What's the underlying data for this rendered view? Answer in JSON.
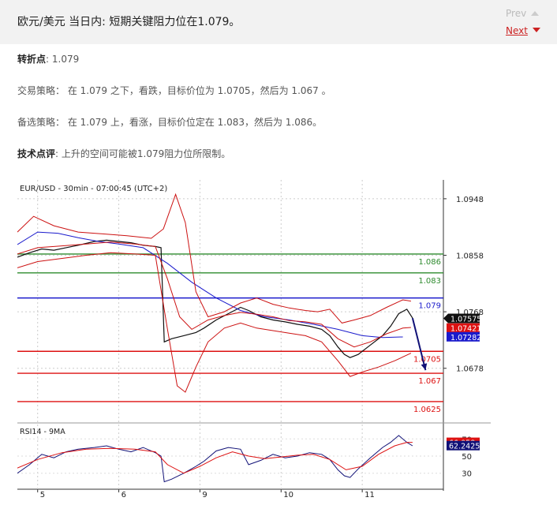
{
  "header": {
    "title": "欧元/美元 当日内: 短期关键阻力位在1.079。",
    "prev_label": "Prev",
    "next_label": "Next"
  },
  "analysis": {
    "pivot_label": "转折点",
    "pivot_value": ": 1.079",
    "strategy_label": "交易策略：",
    "strategy_text": " 在 1.079 之下，看跌，目标价位为 1.0705，然后为 1.067 。",
    "alt_label": "备选策略：",
    "alt_text": " 在 1.079 上，看涨，目标价位定在 1.083，然后为 1.086。",
    "comment_label": "技术点评",
    "comment_text": ": 上升的空间可能被1.079阻力位所限制。"
  },
  "chart_data": {
    "type": "line",
    "title": "EUR/USD - 30min - 07:00:45 (UTC+2)",
    "y_ticks": [
      1.0948,
      1.0858,
      1.0768,
      1.0678
    ],
    "ylim": [
      1.0596,
      1.0978
    ],
    "x_ticks": [
      {
        "label": "5",
        "x": 5.0
      },
      {
        "label": "6",
        "x": 6.0
      },
      {
        "label": "9",
        "x": 7.0
      },
      {
        "label": "10",
        "x": 8.0
      },
      {
        "label": "11",
        "x": 9.0
      }
    ],
    "xlim": [
      4.75,
      10.0
    ],
    "levels": [
      {
        "label": "1.086",
        "value": 1.086,
        "color": "#2e8b2e"
      },
      {
        "label": "1.083",
        "value": 1.083,
        "color": "#2e8b2e"
      },
      {
        "label": "1.079",
        "value": 1.079,
        "color": "#1a1acc"
      },
      {
        "label": "1.0705",
        "value": 1.0705,
        "color": "#dd1111"
      },
      {
        "label": "1.067",
        "value": 1.067,
        "color": "#dd1111"
      },
      {
        "label": "1.0625",
        "value": 1.0625,
        "color": "#dd1111"
      }
    ],
    "price_tags": [
      {
        "label": "1.07575",
        "value": 1.07575,
        "color": "#111111"
      },
      {
        "label": "1.07421",
        "value": 1.07421,
        "color": "#dd1111"
      },
      {
        "label": "1.07282",
        "value": 1.07282,
        "color": "#1a1acc"
      }
    ],
    "series": [
      {
        "color": "#111111",
        "points": [
          [
            4.75,
            1.0855
          ],
          [
            4.9,
            1.0862
          ],
          [
            5.05,
            1.0868
          ],
          [
            5.2,
            1.0866
          ],
          [
            5.35,
            1.087
          ],
          [
            5.5,
            1.0874
          ],
          [
            5.7,
            1.088
          ],
          [
            5.85,
            1.0882
          ],
          [
            6.0,
            1.088
          ],
          [
            6.15,
            1.0878
          ],
          [
            6.3,
            1.0874
          ],
          [
            6.45,
            1.0872
          ],
          [
            6.52,
            1.087
          ],
          [
            6.56,
            1.072
          ],
          [
            6.65,
            1.0725
          ],
          [
            6.8,
            1.073
          ],
          [
            6.95,
            1.0735
          ],
          [
            7.05,
            1.0742
          ],
          [
            7.2,
            1.0755
          ],
          [
            7.35,
            1.0765
          ],
          [
            7.5,
            1.0775
          ],
          [
            7.6,
            1.077
          ],
          [
            7.75,
            1.076
          ],
          [
            7.9,
            1.0755
          ],
          [
            8.05,
            1.0752
          ],
          [
            8.2,
            1.0748
          ],
          [
            8.35,
            1.0745
          ],
          [
            8.5,
            1.074
          ],
          [
            8.6,
            1.073
          ],
          [
            8.7,
            1.0712
          ],
          [
            8.78,
            1.07
          ],
          [
            8.85,
            1.0695
          ],
          [
            8.95,
            1.07
          ],
          [
            9.1,
            1.0715
          ],
          [
            9.25,
            1.073
          ],
          [
            9.35,
            1.0745
          ],
          [
            9.45,
            1.0765
          ],
          [
            9.55,
            1.0772
          ],
          [
            9.62,
            1.0758
          ]
        ]
      },
      {
        "color": "#1a1acc",
        "points": [
          [
            4.75,
            1.0875
          ],
          [
            5.0,
            1.0895
          ],
          [
            5.25,
            1.0893
          ],
          [
            5.5,
            1.0886
          ],
          [
            5.75,
            1.088
          ],
          [
            6.0,
            1.0876
          ],
          [
            6.3,
            1.087
          ],
          [
            6.6,
            1.0845
          ],
          [
            6.9,
            1.0815
          ],
          [
            7.2,
            1.079
          ],
          [
            7.5,
            1.077
          ],
          [
            7.8,
            1.076
          ],
          [
            8.1,
            1.0755
          ],
          [
            8.4,
            1.0748
          ],
          [
            8.7,
            1.074
          ],
          [
            9.0,
            1.073
          ],
          [
            9.25,
            1.0727
          ],
          [
            9.5,
            1.0728
          ]
        ]
      },
      {
        "color": "#cc1111",
        "points": [
          [
            4.75,
            1.0895
          ],
          [
            4.95,
            1.092
          ],
          [
            5.2,
            1.0905
          ],
          [
            5.5,
            1.0895
          ],
          [
            5.8,
            1.0892
          ],
          [
            6.1,
            1.0889
          ],
          [
            6.4,
            1.0885
          ],
          [
            6.55,
            1.09
          ],
          [
            6.7,
            1.0955
          ],
          [
            6.82,
            1.091
          ],
          [
            6.95,
            1.08
          ],
          [
            7.1,
            1.076
          ],
          [
            7.3,
            1.0768
          ],
          [
            7.5,
            1.0782
          ],
          [
            7.7,
            1.079
          ],
          [
            7.9,
            1.078
          ],
          [
            8.1,
            1.0774
          ],
          [
            8.3,
            1.077
          ],
          [
            8.45,
            1.0768
          ],
          [
            8.6,
            1.0772
          ],
          [
            8.75,
            1.075
          ],
          [
            8.9,
            1.0755
          ],
          [
            9.1,
            1.0762
          ],
          [
            9.3,
            1.0775
          ],
          [
            9.5,
            1.0787
          ],
          [
            9.6,
            1.0785
          ]
        ]
      },
      {
        "color": "#cc1111",
        "points": [
          [
            4.75,
            1.086
          ],
          [
            5.0,
            1.087
          ],
          [
            5.3,
            1.0873
          ],
          [
            5.6,
            1.0876
          ],
          [
            5.9,
            1.0879
          ],
          [
            6.2,
            1.0876
          ],
          [
            6.45,
            1.0872
          ],
          [
            6.6,
            1.082
          ],
          [
            6.75,
            1.076
          ],
          [
            6.9,
            1.074
          ],
          [
            7.1,
            1.0755
          ],
          [
            7.3,
            1.0762
          ],
          [
            7.5,
            1.0767
          ],
          [
            7.7,
            1.0764
          ],
          [
            7.9,
            1.076
          ],
          [
            8.1,
            1.0754
          ],
          [
            8.3,
            1.0752
          ],
          [
            8.5,
            1.0748
          ],
          [
            8.7,
            1.0725
          ],
          [
            8.9,
            1.0712
          ],
          [
            9.1,
            1.072
          ],
          [
            9.3,
            1.0733
          ],
          [
            9.5,
            1.0742
          ],
          [
            9.6,
            1.0743
          ]
        ]
      },
      {
        "color": "#cc1111",
        "points": [
          [
            4.75,
            1.0838
          ],
          [
            5.0,
            1.0848
          ],
          [
            5.3,
            1.0853
          ],
          [
            5.6,
            1.0858
          ],
          [
            5.9,
            1.0862
          ],
          [
            6.2,
            1.086
          ],
          [
            6.45,
            1.0858
          ],
          [
            6.6,
            1.074
          ],
          [
            6.72,
            1.065
          ],
          [
            6.82,
            1.064
          ],
          [
            6.95,
            1.068
          ],
          [
            7.1,
            1.072
          ],
          [
            7.3,
            1.0742
          ],
          [
            7.5,
            1.075
          ],
          [
            7.7,
            1.0742
          ],
          [
            7.9,
            1.0738
          ],
          [
            8.1,
            1.0734
          ],
          [
            8.3,
            1.073
          ],
          [
            8.5,
            1.072
          ],
          [
            8.7,
            1.069
          ],
          [
            8.85,
            1.0665
          ],
          [
            9.0,
            1.0672
          ],
          [
            9.2,
            1.068
          ],
          [
            9.4,
            1.069
          ],
          [
            9.6,
            1.0702
          ]
        ]
      }
    ],
    "forecast_arrow": {
      "from": [
        9.62,
        1.0758
      ],
      "to": [
        9.78,
        1.0675
      ],
      "color": "#111177"
    },
    "rsi": {
      "label": "RSI14 - 9MA",
      "ylim": [
        15,
        85
      ],
      "y_ticks": [
        70,
        50,
        30
      ],
      "tags": [
        {
          "label": "66.058",
          "value": 66.058,
          "color": "#dd1111"
        },
        {
          "label": "62.2425",
          "value": 62.2425,
          "color": "#111177"
        }
      ],
      "series": [
        {
          "color": "#111177",
          "points": [
            [
              4.75,
              30
            ],
            [
              4.9,
              40
            ],
            [
              5.05,
              52
            ],
            [
              5.2,
              48
            ],
            [
              5.35,
              55
            ],
            [
              5.5,
              58
            ],
            [
              5.7,
              60
            ],
            [
              5.85,
              62
            ],
            [
              6.0,
              58
            ],
            [
              6.15,
              55
            ],
            [
              6.3,
              60
            ],
            [
              6.45,
              54
            ],
            [
              6.52,
              50
            ],
            [
              6.56,
              20
            ],
            [
              6.65,
              23
            ],
            [
              6.8,
              30
            ],
            [
              6.95,
              38
            ],
            [
              7.05,
              44
            ],
            [
              7.2,
              56
            ],
            [
              7.35,
              60
            ],
            [
              7.5,
              58
            ],
            [
              7.6,
              40
            ],
            [
              7.75,
              45
            ],
            [
              7.9,
              52
            ],
            [
              8.05,
              48
            ],
            [
              8.2,
              50
            ],
            [
              8.35,
              54
            ],
            [
              8.5,
              52
            ],
            [
              8.6,
              46
            ],
            [
              8.7,
              34
            ],
            [
              8.78,
              27
            ],
            [
              8.85,
              25
            ],
            [
              8.95,
              35
            ],
            [
              9.1,
              48
            ],
            [
              9.25,
              60
            ],
            [
              9.35,
              66
            ],
            [
              9.45,
              74
            ],
            [
              9.55,
              66
            ],
            [
              9.62,
              62
            ]
          ]
        },
        {
          "color": "#dd1111",
          "points": [
            [
              4.75,
              36
            ],
            [
              5.0,
              46
            ],
            [
              5.3,
              54
            ],
            [
              5.6,
              58
            ],
            [
              5.9,
              59
            ],
            [
              6.2,
              58
            ],
            [
              6.45,
              55
            ],
            [
              6.6,
              40
            ],
            [
              6.8,
              30
            ],
            [
              7.0,
              38
            ],
            [
              7.2,
              48
            ],
            [
              7.4,
              55
            ],
            [
              7.6,
              50
            ],
            [
              7.8,
              47
            ],
            [
              8.0,
              49
            ],
            [
              8.2,
              51
            ],
            [
              8.4,
              52
            ],
            [
              8.6,
              46
            ],
            [
              8.8,
              34
            ],
            [
              9.0,
              38
            ],
            [
              9.2,
              52
            ],
            [
              9.4,
              62
            ],
            [
              9.55,
              66
            ],
            [
              9.62,
              66
            ]
          ]
        }
      ]
    }
  }
}
